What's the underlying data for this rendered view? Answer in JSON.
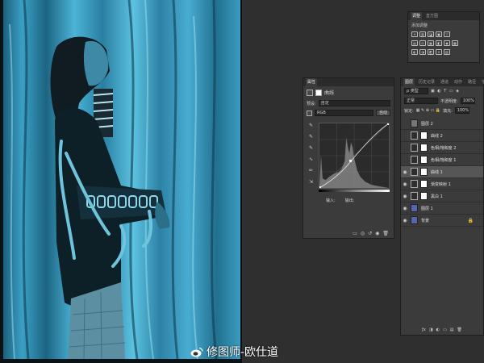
{
  "adjustments": {
    "tabs": [
      "调整",
      "直方图"
    ],
    "title": "添加调整",
    "row1": [
      "☀",
      "▥",
      "◪",
      "▣",
      "▽"
    ],
    "row2": [
      "▤",
      "⚖",
      "▦",
      "◧",
      "◉",
      "▩"
    ],
    "row3": [
      "◐",
      "◑",
      "◩",
      "✕",
      "▧"
    ]
  },
  "properties": {
    "tab": "属性",
    "panel_title": "曲线",
    "preset_label": "预设:",
    "preset_value": "自定",
    "channel_value": "RGB",
    "auto_label": "自动",
    "input_label": "输入:",
    "output_label": "输出:",
    "tools": [
      "✎",
      "✎",
      "✎",
      "∿",
      "✏",
      "⇲"
    ]
  },
  "layers": {
    "tabs": [
      "图层",
      "历史记录",
      "通道",
      "动作",
      "路径",
      "字符"
    ],
    "filter_value": "ρ 类型",
    "blend_mode": "正常",
    "opacity_label": "不透明度:",
    "opacity_value": "100%",
    "lock_label": "锁定:",
    "fill_label": "填充:",
    "fill_value": "100%",
    "rows": [
      {
        "name": "图层 2",
        "visible": false,
        "type": "plain",
        "mask": false
      },
      {
        "name": "曲线 2",
        "visible": false,
        "type": "adj",
        "mask": true
      },
      {
        "name": "色相/饱和度 2",
        "visible": false,
        "type": "adj",
        "mask": true
      },
      {
        "name": "色相/饱和度 1",
        "visible": false,
        "type": "adj",
        "mask": true
      },
      {
        "name": "曲线 1",
        "visible": true,
        "type": "adj",
        "mask": true
      },
      {
        "name": "渐变映射 1",
        "visible": true,
        "type": "adj",
        "mask": true
      },
      {
        "name": "黑白 1",
        "visible": true,
        "type": "adj",
        "mask": true
      },
      {
        "name": "图层 1",
        "visible": true,
        "type": "photo",
        "mask": false
      },
      {
        "name": "背景",
        "visible": true,
        "type": "photo",
        "mask": false
      }
    ],
    "footer": [
      "ƒx",
      "◨",
      "◐",
      "▭",
      "▤",
      "🗑"
    ]
  },
  "watermark": "修图师-欧仕道",
  "colors": {
    "photo_cyan": "#2f8fb0",
    "photo_dark": "#0d2430",
    "panel_bg": "#3b3b3b"
  }
}
